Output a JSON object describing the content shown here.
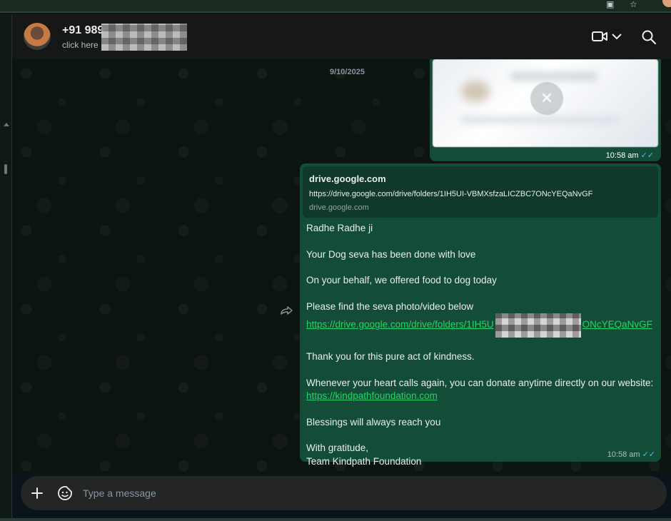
{
  "header": {
    "contact_name": "+91 989",
    "subtitle": "click here",
    "icons": [
      "video-call-icon",
      "chevron-down-icon",
      "search-icon"
    ]
  },
  "chat": {
    "date_chip": "9/10/2025",
    "image_message": {
      "time": "10:58 am",
      "status": "read"
    },
    "text_message": {
      "link_preview": {
        "title": "drive.google.com",
        "url": "https://drive.google.com/drive/folders/1IH5UI-VBMXsfzaLICZBC7ONcYEQaNvGF",
        "domain": "drive.google.com"
      },
      "lines": {
        "greeting": "Radhe Radhe ji",
        "line1": "Your Dog seva has been done with love",
        "line2": "On your behalf, we offered food to dog today",
        "line3": "Please find the seva photo/video below",
        "link_part1": "https://drive.google.com/drive/folders/1IH5U",
        "link_part2": "ONcYEQaNvGF",
        "line4": "Thank you for this pure act of kindness.",
        "line5": "Whenever your heart calls again, you can donate anytime directly on our website:",
        "website_link": "https://kindpathfoundation.com",
        "line6": "Blessings will always reach you",
        "signoff1": "With gratitude,",
        "signoff2": "Team Kindpath Foundation"
      },
      "time": "10:58 am",
      "status": "read"
    }
  },
  "composer": {
    "placeholder": "Type a message"
  },
  "colors": {
    "outgoing_bubble": "#144d37",
    "link": "#25d366",
    "read_tick": "#53bdeb"
  }
}
